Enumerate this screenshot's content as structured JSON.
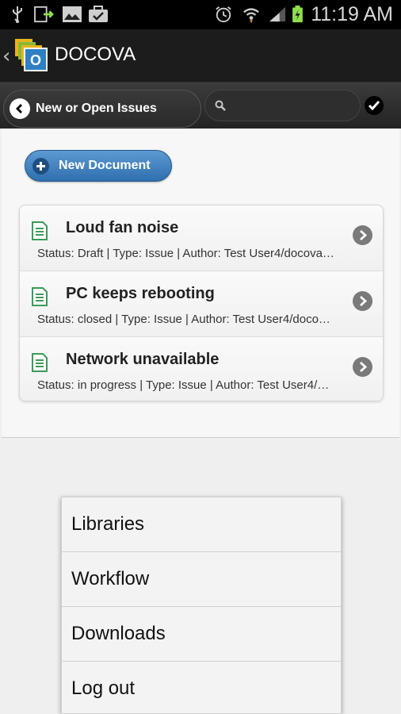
{
  "status_bar": {
    "time": "11:19 AM",
    "icons": [
      "usb-icon",
      "download-icon",
      "gallery-icon",
      "briefcase-icon",
      "alarm-icon",
      "wifi-icon",
      "signal-icon",
      "battery-charging-icon"
    ]
  },
  "app_bar": {
    "title": "DOCOVA"
  },
  "toolbar": {
    "back_label": "New or Open Issues",
    "search_value": "",
    "search_placeholder": ""
  },
  "new_document_label": "New Document",
  "documents": [
    {
      "title": "Loud fan noise",
      "meta": "Status: Draft  |  Type: Issue  |  Author: Test User4/docova…"
    },
    {
      "title": "PC keeps rebooting",
      "meta": "Status: closed  |  Type: Issue  |  Author: Test User4/doco…"
    },
    {
      "title": "Network unavailable",
      "meta": "Status: in progress  |  Type: Issue  |  Author: Test User4/…"
    }
  ],
  "menu": {
    "items": [
      {
        "label": "Libraries"
      },
      {
        "label": "Workflow"
      },
      {
        "label": "Downloads"
      },
      {
        "label": "Log out"
      }
    ]
  },
  "colors": {
    "accent_blue": "#2f6fae",
    "battery_green": "#8ee04a",
    "doc_icon_green": "#3c9a5a"
  }
}
